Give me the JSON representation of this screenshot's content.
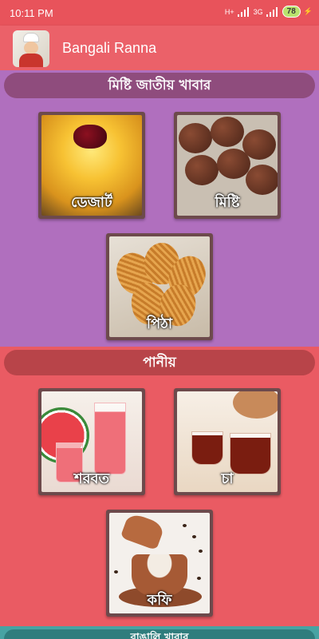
{
  "status": {
    "time": "10:11 PM",
    "net1": "H+",
    "net2": "3G",
    "battery": "78"
  },
  "app": {
    "title": "Bangali Ranna"
  },
  "sections": [
    {
      "title": "মিষ্টি জাতীয় খাবার",
      "items": [
        {
          "label": "ডেজার্ট"
        },
        {
          "label": "মিষ্টি"
        },
        {
          "label": "পিঠা"
        }
      ]
    },
    {
      "title": "পানীয়",
      "items": [
        {
          "label": "শরবত"
        },
        {
          "label": "চা"
        },
        {
          "label": "কফি"
        }
      ]
    },
    {
      "title": "বাঙালি খাবার"
    }
  ],
  "colors": {
    "section1": "#b06fbe",
    "section2": "#ea5b63",
    "section3": "#47a3a3",
    "appbar": "#eb6169"
  }
}
